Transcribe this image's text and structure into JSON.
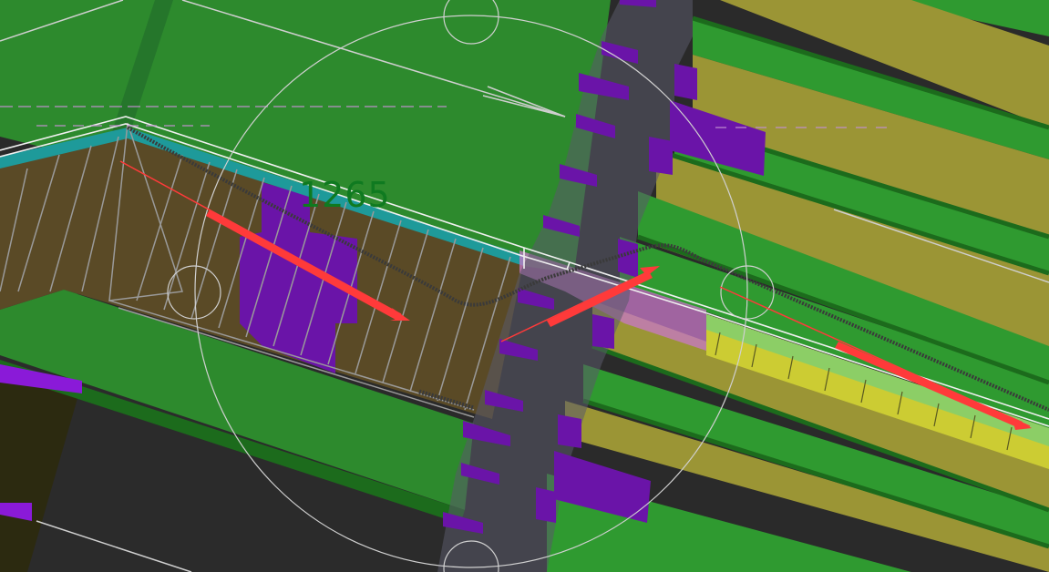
{
  "viewport": {
    "dimension_label": "1265"
  },
  "colors": {
    "background": "#2a2a2a",
    "ground_green": "#2d8a2d",
    "slope_green": "#2f9a30",
    "terrace_dark": "#1c6b1c",
    "terrace_olive": "#9b9535",
    "terrace_yellow": "#cccc33",
    "strip_green": "#8cce66",
    "trench_brown": "#5a4a26",
    "teal_band": "#1e9a9a",
    "purple": "#6a14a8",
    "purple_bright": "#8a1ad8",
    "ghost_grey": "#5a5a6a",
    "pink": "#c878c8",
    "arrow_red": "#ff3a3a",
    "dimension_text": "#0f7a20",
    "overlay_lines": "#d8d8d8",
    "cable": "#3a3a3a"
  },
  "icons": {
    "orbit_gizmo": "orbit-gizmo-icon",
    "direction_arrows": "direction-arrow-icon"
  }
}
